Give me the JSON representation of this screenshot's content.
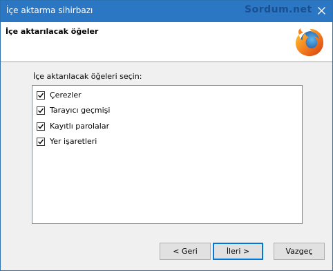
{
  "window": {
    "title": "İçe aktarma sihirbazı",
    "watermark": "Sordum.net"
  },
  "header": {
    "title": "İçe aktarılacak öğeler",
    "logo_icon": "firefox-logo-icon"
  },
  "main": {
    "section_label": "İçe aktarılacak öğeleri seçin:",
    "items": [
      {
        "label": "Çerezler",
        "checked": true
      },
      {
        "label": "Tarayıcı geçmişi",
        "checked": true
      },
      {
        "label": "Kayıtlı parolalar",
        "checked": true
      },
      {
        "label": "Yer işaretleri",
        "checked": true
      }
    ]
  },
  "buttons": {
    "back": "< Geri",
    "next": "İleri >",
    "cancel": "Vazgeç"
  },
  "colors": {
    "titlebar": "#2b77c4",
    "accent": "#0078d7"
  }
}
